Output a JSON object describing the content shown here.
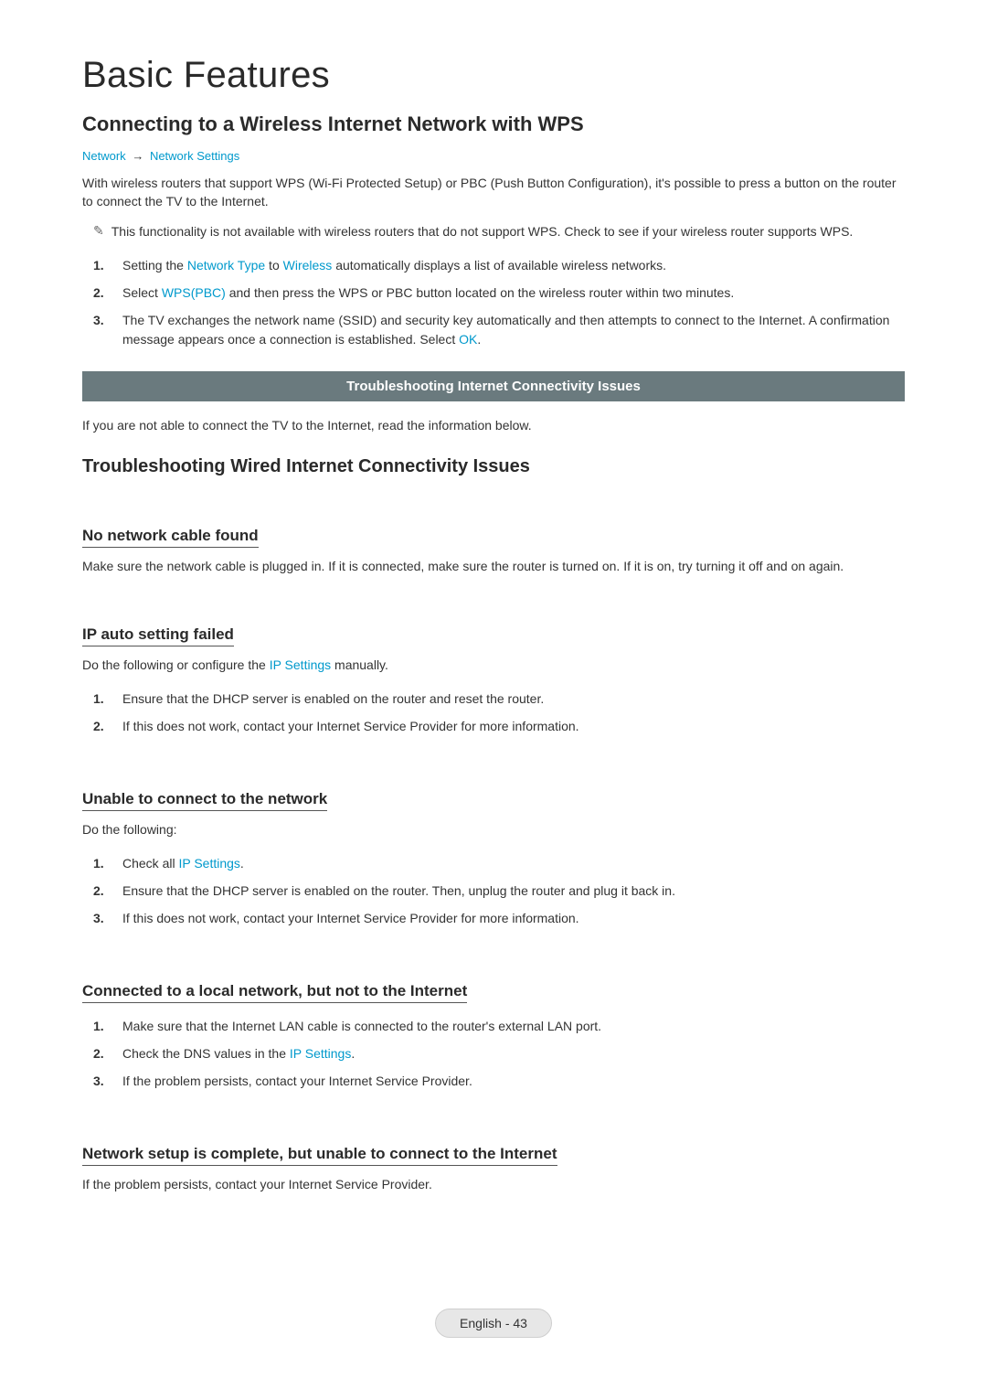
{
  "section_title": "Basic Features",
  "h1": "Connecting to a Wireless Internet Network with WPS",
  "breadcrumb": {
    "a": "Network",
    "sep": "→",
    "b": "Network Settings"
  },
  "intro": "With wireless routers that support WPS (Wi-Fi Protected Setup) or PBC (Push Button Configuration), it's possible to press a button on the router to connect the TV to the Internet.",
  "note": "This functionality is not available with wireless routers that do not support WPS. Check to see if your wireless router supports WPS.",
  "steps": {
    "s1a": "Setting the ",
    "s1_link1": "Network Type",
    "s1b": " to ",
    "s1_link2": "Wireless",
    "s1c": " automatically displays a list of available wireless networks.",
    "s2a": "Select ",
    "s2_link": "WPS(PBC)",
    "s2b": " and then press the WPS or PBC button located on the wireless router within two minutes.",
    "s3a": "The TV exchanges the network name (SSID) and security key automatically and then attempts to connect to the Internet. A confirmation message appears once a connection is established. Select ",
    "s3_link": "OK",
    "s3b": "."
  },
  "callout": "Troubleshooting Internet Connectivity Issues",
  "callout_sub": "If you are not able to connect the TV to the Internet, read the information below.",
  "h2": "Troubleshooting Wired Internet Connectivity Issues",
  "sec_a": {
    "title": "No network cable found",
    "body": "Make sure the network cable is plugged in. If it is connected, make sure the router is turned on. If it is on, try turning it off and on again."
  },
  "sec_b": {
    "title": "IP auto setting failed",
    "body_a": "Do the following or configure the ",
    "body_link": "IP Settings",
    "body_b": " manually.",
    "li1": "Ensure that the DHCP server is enabled on the router and reset the router.",
    "li2": "If this does not work, contact your Internet Service Provider for more information."
  },
  "sec_c": {
    "title": "Unable to connect to the network",
    "body": "Do the following:",
    "li1a": "Check all ",
    "li1_link": "IP Settings",
    "li1b": ".",
    "li2": "Ensure that the DHCP server is enabled on the router. Then, unplug the router and plug it back in.",
    "li3": "If this does not work, contact your Internet Service Provider for more information."
  },
  "sec_d": {
    "title": "Connected to a local network, but not to the Internet",
    "li1": "Make sure that the Internet LAN cable is connected to the router's external LAN port.",
    "li2a": "Check the DNS values in the ",
    "li2_link": "IP Settings",
    "li2b": ".",
    "li3": "If the problem persists, contact your Internet Service Provider."
  },
  "sec_e": {
    "title": "Network setup is complete, but unable to connect to the Internet",
    "body": "If the problem persists, contact your Internet Service Provider."
  },
  "footer": "English - 43",
  "idx": {
    "n1": "1.",
    "n2": "2.",
    "n3": "3."
  },
  "note_glyph": "✎"
}
